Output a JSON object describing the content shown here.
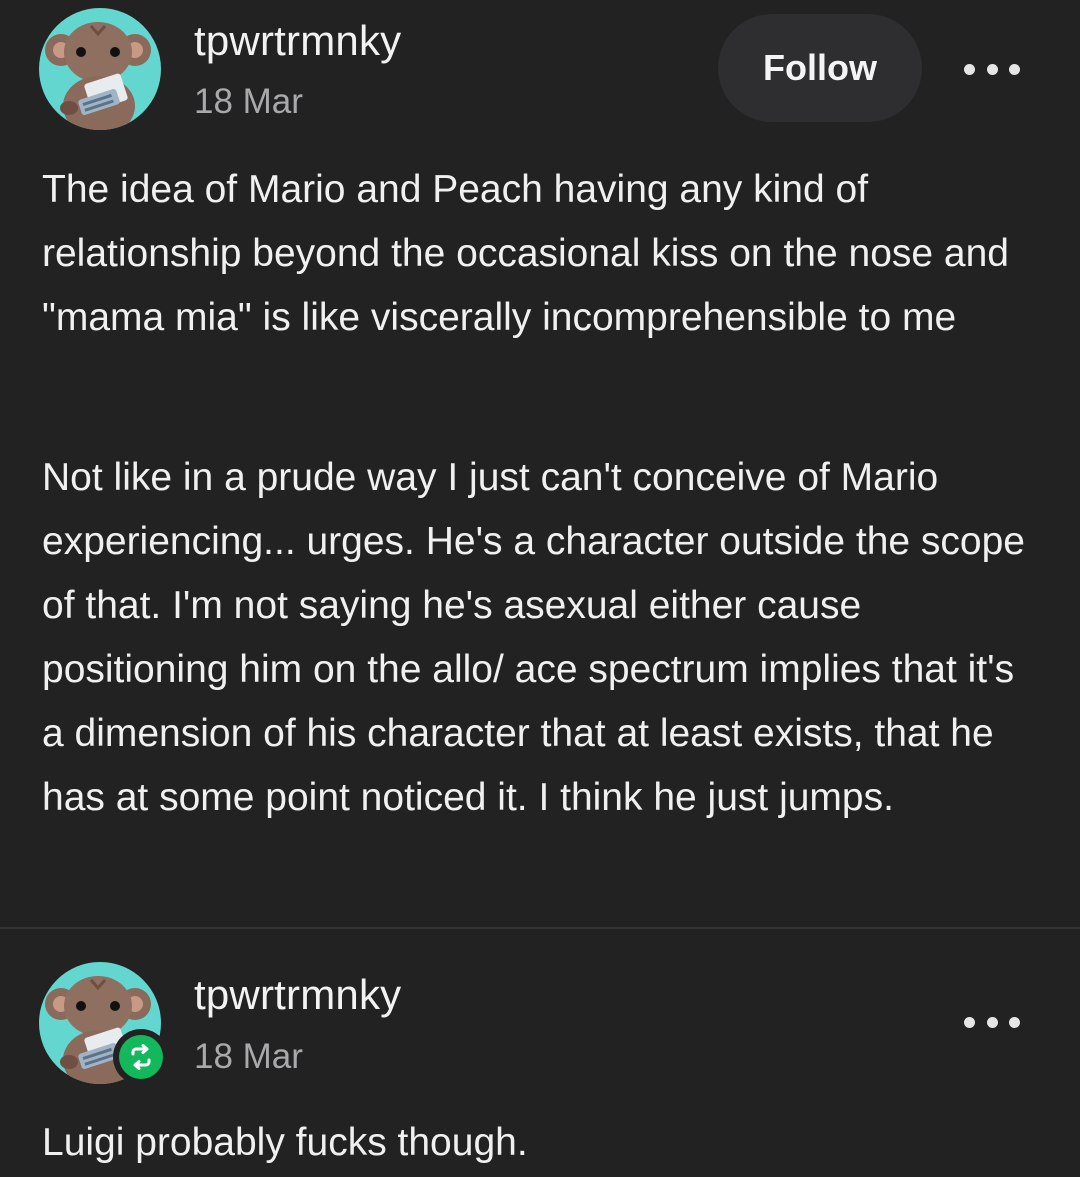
{
  "posts": [
    {
      "username": "tpwrtrmnky",
      "date": "18 Mar",
      "follow_label": "Follow",
      "paragraphs": [
        "The idea of Mario and Peach having any kind of relationship beyond the occasional kiss on the nose and \"mama mia\" is like viscerally incomprehensible to me",
        "Not like in a prude way I just can't conceive of Mario experiencing... urges. He's a character outside the scope of that. I'm not saying he's asexual either cause positioning him on the allo/ ace spectrum implies that it's a dimension of his character that at least exists, that he has at some point noticed it. I think he just jumps."
      ],
      "icons": [
        "avatar",
        "more-icon"
      ]
    },
    {
      "username": "tpwrtrmnky",
      "date": "18 Mar",
      "paragraphs": [
        "Luigi probably fucks though."
      ],
      "icons": [
        "avatar",
        "reblog-icon",
        "more-icon"
      ]
    }
  ],
  "colors": {
    "background": "#222223",
    "follow_button": "#2e2e30",
    "avatar_bg": "#63d6cf",
    "reblog_badge": "#14b85c",
    "secondary_text": "#a9a9ab"
  }
}
